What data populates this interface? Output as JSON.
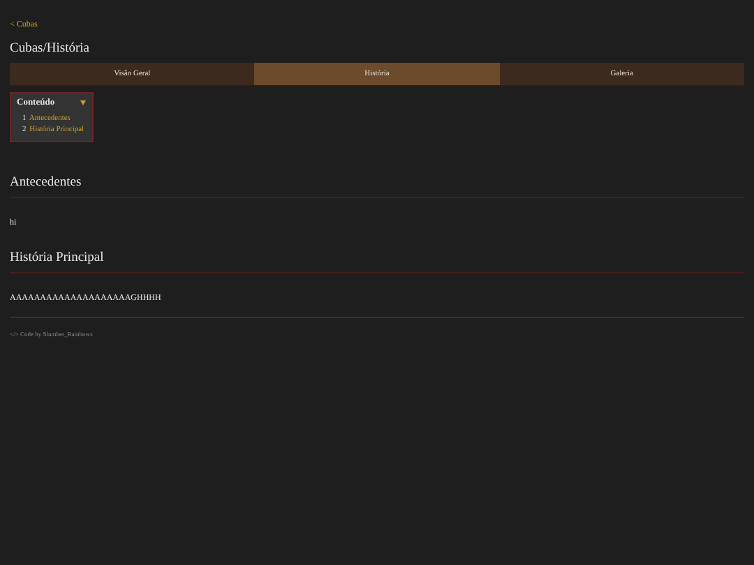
{
  "back_link": "< Cubas",
  "page_title": "Cubas/História",
  "tabs": [
    {
      "label": "Visão Geral",
      "selected": false
    },
    {
      "label": "História",
      "selected": true
    },
    {
      "label": "Galeria",
      "selected": false
    }
  ],
  "toc": {
    "title": "Conteúdo",
    "expanded": true,
    "items": [
      {
        "number": "1",
        "label": "Antecedentes"
      },
      {
        "number": "2",
        "label": "História Principal"
      }
    ]
  },
  "sections": [
    {
      "heading": "Antecedentes",
      "body": "hi"
    },
    {
      "heading": "História Principal",
      "body": "AAAAAAAAAAAAAAAAAAAAGHHHH"
    }
  ],
  "footer": "</> Code by Slumber_Rainbowz"
}
